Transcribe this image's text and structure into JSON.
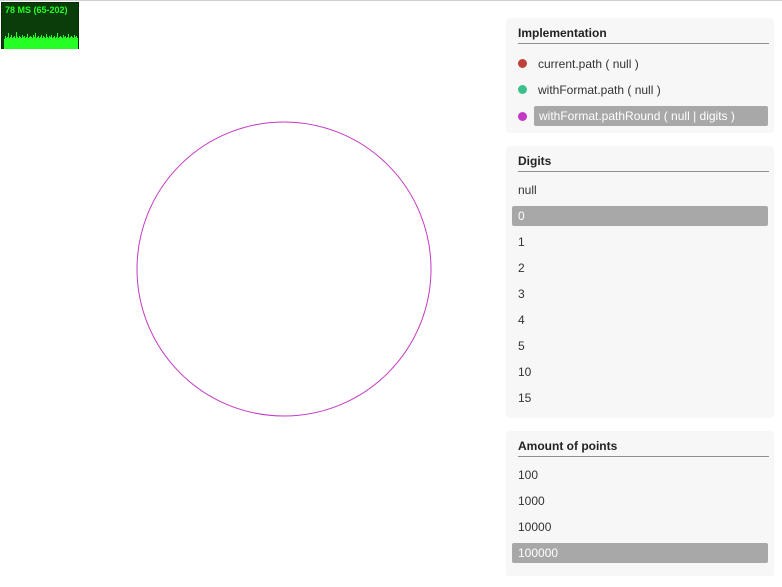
{
  "fps": {
    "label": "78 MS (65-202)",
    "color": "#25ff25",
    "background": "#0a3d0a"
  },
  "canvas": {
    "circle_color": "#c43ac4"
  },
  "implementation": {
    "title": "Implementation",
    "items": [
      {
        "label": "current.path ( null )",
        "color": "#c0403a",
        "selected": false
      },
      {
        "label": "withFormat.path ( null )",
        "color": "#3cc08a",
        "selected": false
      },
      {
        "label": "withFormat.pathRound ( null | digits )",
        "color": "#c43ac4",
        "selected": true
      }
    ]
  },
  "digits": {
    "title": "Digits",
    "items": [
      {
        "label": "null",
        "selected": false
      },
      {
        "label": "0",
        "selected": true
      },
      {
        "label": "1",
        "selected": false
      },
      {
        "label": "2",
        "selected": false
      },
      {
        "label": "3",
        "selected": false
      },
      {
        "label": "4",
        "selected": false
      },
      {
        "label": "5",
        "selected": false
      },
      {
        "label": "10",
        "selected": false
      },
      {
        "label": "15",
        "selected": false
      }
    ]
  },
  "points": {
    "title": "Amount of points",
    "items": [
      {
        "label": "100",
        "selected": false
      },
      {
        "label": "1000",
        "selected": false
      },
      {
        "label": "10000",
        "selected": false
      },
      {
        "label": "100000",
        "selected": true
      }
    ]
  }
}
